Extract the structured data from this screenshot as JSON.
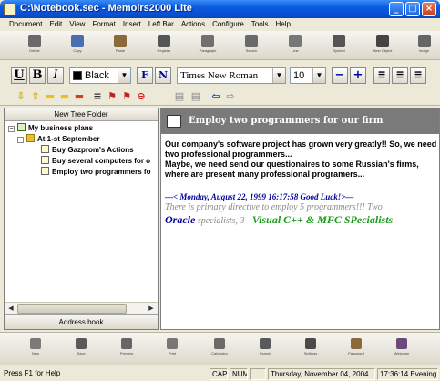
{
  "window": {
    "title": "C:\\Notebook.sec - Memoirs2000 Lite",
    "min_glyph": "_",
    "max_glyph": "□",
    "close_glyph": "×"
  },
  "menu": [
    "Document",
    "Edit",
    "View",
    "Format",
    "Insert",
    "Left Bar",
    "Actions",
    "Configure",
    "Tools",
    "Help"
  ],
  "big_toolbar": [
    {
      "label": "Delete",
      "icon": "trash-icon",
      "color": "#6a6a6a"
    },
    {
      "label": "Copy",
      "icon": "copy-icon",
      "color": "#4a6fb0"
    },
    {
      "label": "Paste",
      "icon": "paste-icon",
      "color": "#8a6a3a"
    },
    {
      "label": "Register",
      "icon": "register-icon",
      "color": "#555555"
    },
    {
      "label": "Paragraph",
      "icon": "paragraph-icon",
      "color": "#707070"
    },
    {
      "label": "Search",
      "icon": "search-icon",
      "color": "#6a6a6a"
    },
    {
      "label": "Line",
      "icon": "line-icon",
      "color": "#777777"
    },
    {
      "label": "Symbol",
      "icon": "symbol-icon",
      "color": "#555555"
    },
    {
      "label": "New Object",
      "icon": "object-icon",
      "color": "#444444"
    },
    {
      "label": "Image",
      "icon": "image-icon",
      "color": "#666666"
    }
  ],
  "format": {
    "bold": "B",
    "italic": "I",
    "underline": "U",
    "color_value": "Black",
    "color_swatch": "#000000",
    "font_f": "F",
    "font_n": "N",
    "font_value": "Times New Roman",
    "size_value": "10",
    "minus": "−",
    "plus": "+"
  },
  "tree": {
    "header": "New Tree Folder",
    "items": [
      {
        "label": "My business plans",
        "icon": "checkbox-icon",
        "level": 0
      },
      {
        "label": "At 1-st September",
        "icon": "folder-icon",
        "level": 1
      },
      {
        "label": "Buy Gazprom's Actions",
        "icon": "note-icon",
        "level": 2
      },
      {
        "label": "Buy several computers for o",
        "icon": "note-icon",
        "level": 2
      },
      {
        "label": "Employ two programmers fo",
        "icon": "note-icon",
        "level": 2
      }
    ],
    "footer": "Address book"
  },
  "note": {
    "title": "Employ two programmers for our firm",
    "para1": "Our company's software project has grown very greatly!! So, we need two professional programmers...",
    "para2": "Maybe, we need send our questionaires to some Russian's firms, where are present many professional programers...",
    "date_line": "—< Monday, August 22, 1999  16:17:58  Good Luck!>—",
    "grey_line": "There is primary directive to employ 5 programmers!!! Two",
    "oracle": "Oracle",
    "middle": " specialists, 3 - ",
    "vcpp": "Visual C++ & MFC SPecialists"
  },
  "bottom_toolbar": [
    {
      "label": "New",
      "color": "#7a7a7a"
    },
    {
      "label": "Save",
      "color": "#5a5a5a"
    },
    {
      "label": "Preview",
      "color": "#666666"
    },
    {
      "label": "Print",
      "color": "#777777"
    },
    {
      "label": "Calculator",
      "color": "#6a6a6a"
    },
    {
      "label": "Search",
      "color": "#5a5a5a"
    },
    {
      "label": "Settings",
      "color": "#4a4a4a"
    },
    {
      "label": "Password",
      "color": "#8a6a3a"
    },
    {
      "label": "Welcome",
      "color": "#6a4a7a"
    }
  ],
  "status": {
    "help": "Press F1 for Help",
    "cap": "CAP",
    "num": "NUM",
    "date": "Thursday, November 04, 2004",
    "time": "17:36:14 Evening"
  }
}
